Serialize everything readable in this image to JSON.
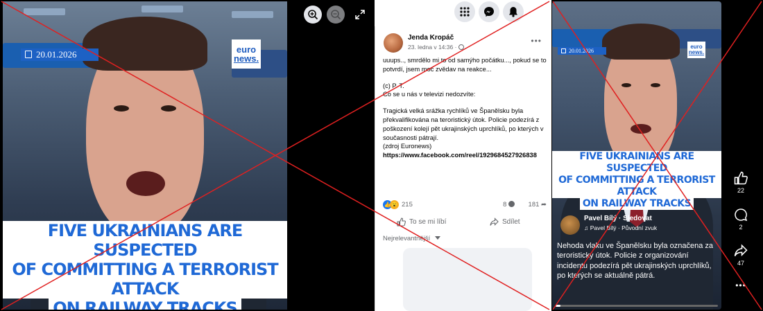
{
  "left_video": {
    "date_label": "20.01.2026",
    "logo_line1": "euro",
    "logo_line2": "news.",
    "caption_lines": [
      "FIVE UKRAINIANS ARE SUSPECTED",
      "OF COMMITTING A TERRORIST ATTACK",
      "ON RAILWAY TRACKS"
    ],
    "zoom_in_icon": "zoom-in-icon",
    "zoom_out_icon": "zoom-out-icon",
    "fullscreen_icon": "expand-icon"
  },
  "top_bar": {
    "icons": [
      "apps-grid-icon",
      "messenger-icon",
      "bell-icon"
    ]
  },
  "post": {
    "author": "Jenda Kropáč",
    "date": "23. ledna v 14:36 · ",
    "globe_icon": "globe-icon",
    "menu": "•••",
    "text_1": "uuups.., smrdělo mi to od samýho počátku..., pokud se to potvrdí, jsem moc zvědav na reakce...",
    "text_2": "(c) P. T.\nCo se u nás v televizi nedozvíte:",
    "text_3": "Tragická velká srážka rychlíků ve Španělsku byla překvalifikována na teroristický útok. Policie podezírá z poškození kolejí pět ukrajinských uprchlíků, po kterých v současnosti pátrají.\n(zdroj Euronews)",
    "link": "https://www.facebook.com/reel/1929684527926838",
    "reaction_count": "215",
    "comment_count": "8",
    "share_count": "181",
    "like_label": "To se mi líbí",
    "share_label": "Sdílet",
    "sort_label": "Nejrelevantnější"
  },
  "reel": {
    "date_label": "20.01.2026",
    "logo_line1": "euro",
    "logo_line2": "news.",
    "caption_lines": [
      "FIVE UKRAINIANS ARE SUSPECTED",
      "OF COMMITTING A TERRORIST ATTACK",
      "ON RAILWAY TRACKS"
    ],
    "author": "Pavel Bílý",
    "follow": "· Sledovat",
    "audio": "♫ Pavel Bílý · Původní zvuk",
    "text": "Nehoda vlaku ve Španělsku byla označena za teroristický útok. Policie z organizování incidentu podezírá pět ukrajinských uprchlíků, po kterých se aktuálně pátrá.",
    "likes": "22",
    "comments": "2",
    "shares": "47",
    "more": "•••",
    "progress": 0.03
  },
  "colors": {
    "facebook_blue": "#1877f2",
    "caption_blue": "#1f69d6",
    "cross_red": "#e02020"
  }
}
